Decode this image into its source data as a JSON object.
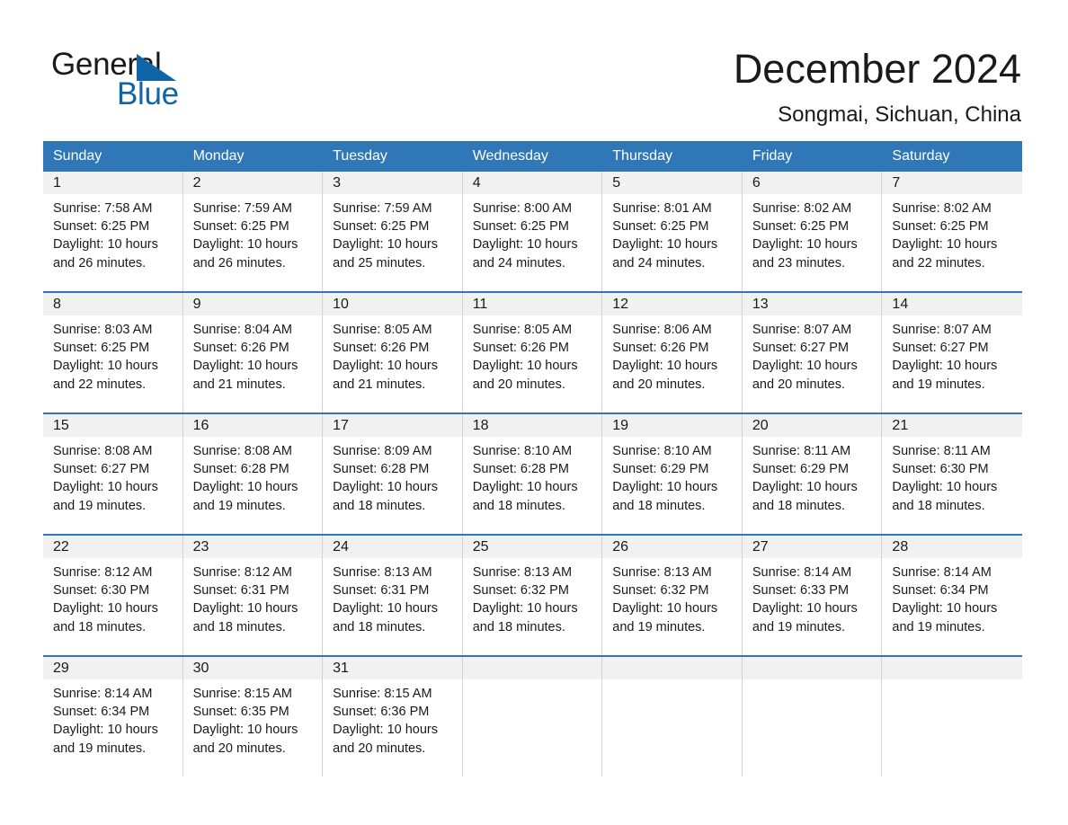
{
  "brand": {
    "name_part1": "General",
    "name_part2": "Blue",
    "triangle_icon": "triangle-icon",
    "colors": {
      "blue": "#1064a8",
      "header_blue": "#2f77b7",
      "band_gray": "#f1f1f1"
    }
  },
  "header": {
    "title": "December 2024",
    "location": "Songmai, Sichuan, China"
  },
  "weekdays": [
    "Sunday",
    "Monday",
    "Tuesday",
    "Wednesday",
    "Thursday",
    "Friday",
    "Saturday"
  ],
  "weeks": [
    [
      {
        "day": "1",
        "sunrise": "Sunrise: 7:58 AM",
        "sunset": "Sunset: 6:25 PM",
        "daylight": "Daylight: 10 hours and 26 minutes."
      },
      {
        "day": "2",
        "sunrise": "Sunrise: 7:59 AM",
        "sunset": "Sunset: 6:25 PM",
        "daylight": "Daylight: 10 hours and 26 minutes."
      },
      {
        "day": "3",
        "sunrise": "Sunrise: 7:59 AM",
        "sunset": "Sunset: 6:25 PM",
        "daylight": "Daylight: 10 hours and 25 minutes."
      },
      {
        "day": "4",
        "sunrise": "Sunrise: 8:00 AM",
        "sunset": "Sunset: 6:25 PM",
        "daylight": "Daylight: 10 hours and 24 minutes."
      },
      {
        "day": "5",
        "sunrise": "Sunrise: 8:01 AM",
        "sunset": "Sunset: 6:25 PM",
        "daylight": "Daylight: 10 hours and 24 minutes."
      },
      {
        "day": "6",
        "sunrise": "Sunrise: 8:02 AM",
        "sunset": "Sunset: 6:25 PM",
        "daylight": "Daylight: 10 hours and 23 minutes."
      },
      {
        "day": "7",
        "sunrise": "Sunrise: 8:02 AM",
        "sunset": "Sunset: 6:25 PM",
        "daylight": "Daylight: 10 hours and 22 minutes."
      }
    ],
    [
      {
        "day": "8",
        "sunrise": "Sunrise: 8:03 AM",
        "sunset": "Sunset: 6:25 PM",
        "daylight": "Daylight: 10 hours and 22 minutes."
      },
      {
        "day": "9",
        "sunrise": "Sunrise: 8:04 AM",
        "sunset": "Sunset: 6:26 PM",
        "daylight": "Daylight: 10 hours and 21 minutes."
      },
      {
        "day": "10",
        "sunrise": "Sunrise: 8:05 AM",
        "sunset": "Sunset: 6:26 PM",
        "daylight": "Daylight: 10 hours and 21 minutes."
      },
      {
        "day": "11",
        "sunrise": "Sunrise: 8:05 AM",
        "sunset": "Sunset: 6:26 PM",
        "daylight": "Daylight: 10 hours and 20 minutes."
      },
      {
        "day": "12",
        "sunrise": "Sunrise: 8:06 AM",
        "sunset": "Sunset: 6:26 PM",
        "daylight": "Daylight: 10 hours and 20 minutes."
      },
      {
        "day": "13",
        "sunrise": "Sunrise: 8:07 AM",
        "sunset": "Sunset: 6:27 PM",
        "daylight": "Daylight: 10 hours and 20 minutes."
      },
      {
        "day": "14",
        "sunrise": "Sunrise: 8:07 AM",
        "sunset": "Sunset: 6:27 PM",
        "daylight": "Daylight: 10 hours and 19 minutes."
      }
    ],
    [
      {
        "day": "15",
        "sunrise": "Sunrise: 8:08 AM",
        "sunset": "Sunset: 6:27 PM",
        "daylight": "Daylight: 10 hours and 19 minutes."
      },
      {
        "day": "16",
        "sunrise": "Sunrise: 8:08 AM",
        "sunset": "Sunset: 6:28 PM",
        "daylight": "Daylight: 10 hours and 19 minutes."
      },
      {
        "day": "17",
        "sunrise": "Sunrise: 8:09 AM",
        "sunset": "Sunset: 6:28 PM",
        "daylight": "Daylight: 10 hours and 18 minutes."
      },
      {
        "day": "18",
        "sunrise": "Sunrise: 8:10 AM",
        "sunset": "Sunset: 6:28 PM",
        "daylight": "Daylight: 10 hours and 18 minutes."
      },
      {
        "day": "19",
        "sunrise": "Sunrise: 8:10 AM",
        "sunset": "Sunset: 6:29 PM",
        "daylight": "Daylight: 10 hours and 18 minutes."
      },
      {
        "day": "20",
        "sunrise": "Sunrise: 8:11 AM",
        "sunset": "Sunset: 6:29 PM",
        "daylight": "Daylight: 10 hours and 18 minutes."
      },
      {
        "day": "21",
        "sunrise": "Sunrise: 8:11 AM",
        "sunset": "Sunset: 6:30 PM",
        "daylight": "Daylight: 10 hours and 18 minutes."
      }
    ],
    [
      {
        "day": "22",
        "sunrise": "Sunrise: 8:12 AM",
        "sunset": "Sunset: 6:30 PM",
        "daylight": "Daylight: 10 hours and 18 minutes."
      },
      {
        "day": "23",
        "sunrise": "Sunrise: 8:12 AM",
        "sunset": "Sunset: 6:31 PM",
        "daylight": "Daylight: 10 hours and 18 minutes."
      },
      {
        "day": "24",
        "sunrise": "Sunrise: 8:13 AM",
        "sunset": "Sunset: 6:31 PM",
        "daylight": "Daylight: 10 hours and 18 minutes."
      },
      {
        "day": "25",
        "sunrise": "Sunrise: 8:13 AM",
        "sunset": "Sunset: 6:32 PM",
        "daylight": "Daylight: 10 hours and 18 minutes."
      },
      {
        "day": "26",
        "sunrise": "Sunrise: 8:13 AM",
        "sunset": "Sunset: 6:32 PM",
        "daylight": "Daylight: 10 hours and 19 minutes."
      },
      {
        "day": "27",
        "sunrise": "Sunrise: 8:14 AM",
        "sunset": "Sunset: 6:33 PM",
        "daylight": "Daylight: 10 hours and 19 minutes."
      },
      {
        "day": "28",
        "sunrise": "Sunrise: 8:14 AM",
        "sunset": "Sunset: 6:34 PM",
        "daylight": "Daylight: 10 hours and 19 minutes."
      }
    ],
    [
      {
        "day": "29",
        "sunrise": "Sunrise: 8:14 AM",
        "sunset": "Sunset: 6:34 PM",
        "daylight": "Daylight: 10 hours and 19 minutes."
      },
      {
        "day": "30",
        "sunrise": "Sunrise: 8:15 AM",
        "sunset": "Sunset: 6:35 PM",
        "daylight": "Daylight: 10 hours and 20 minutes."
      },
      {
        "day": "31",
        "sunrise": "Sunrise: 8:15 AM",
        "sunset": "Sunset: 6:36 PM",
        "daylight": "Daylight: 10 hours and 20 minutes."
      },
      {
        "day": "",
        "sunrise": "",
        "sunset": "",
        "daylight": ""
      },
      {
        "day": "",
        "sunrise": "",
        "sunset": "",
        "daylight": ""
      },
      {
        "day": "",
        "sunrise": "",
        "sunset": "",
        "daylight": ""
      },
      {
        "day": "",
        "sunrise": "",
        "sunset": "",
        "daylight": ""
      }
    ]
  ]
}
